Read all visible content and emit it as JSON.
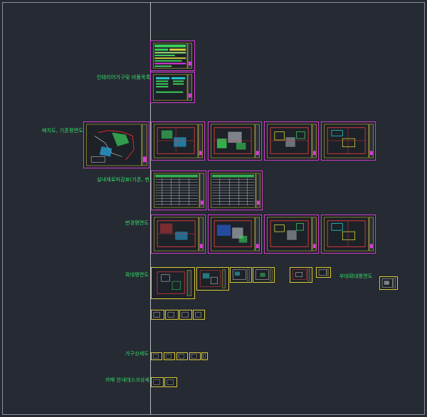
{
  "app": "CAD layout viewer",
  "labels": {
    "interior_furniture": "인테리어가구및 비품목록",
    "site_plan": "배치도, 기존평면도",
    "finish_schedule": "실내재료마감표(기존, 변경",
    "changed_plan": "변경평면도",
    "enlarged_plan": "확대평면도",
    "partial_enlarged": "부대확대평면도",
    "furniture_detail": "가구상세도",
    "cafe_desk_detail": "카페 안내데스크상세"
  },
  "colors": {
    "background": "#262b33",
    "sheet_border": "#d43cd4",
    "title_block": "#c9c23a",
    "label_text": "#34e36a",
    "axis_line": "#b8bcc2"
  }
}
